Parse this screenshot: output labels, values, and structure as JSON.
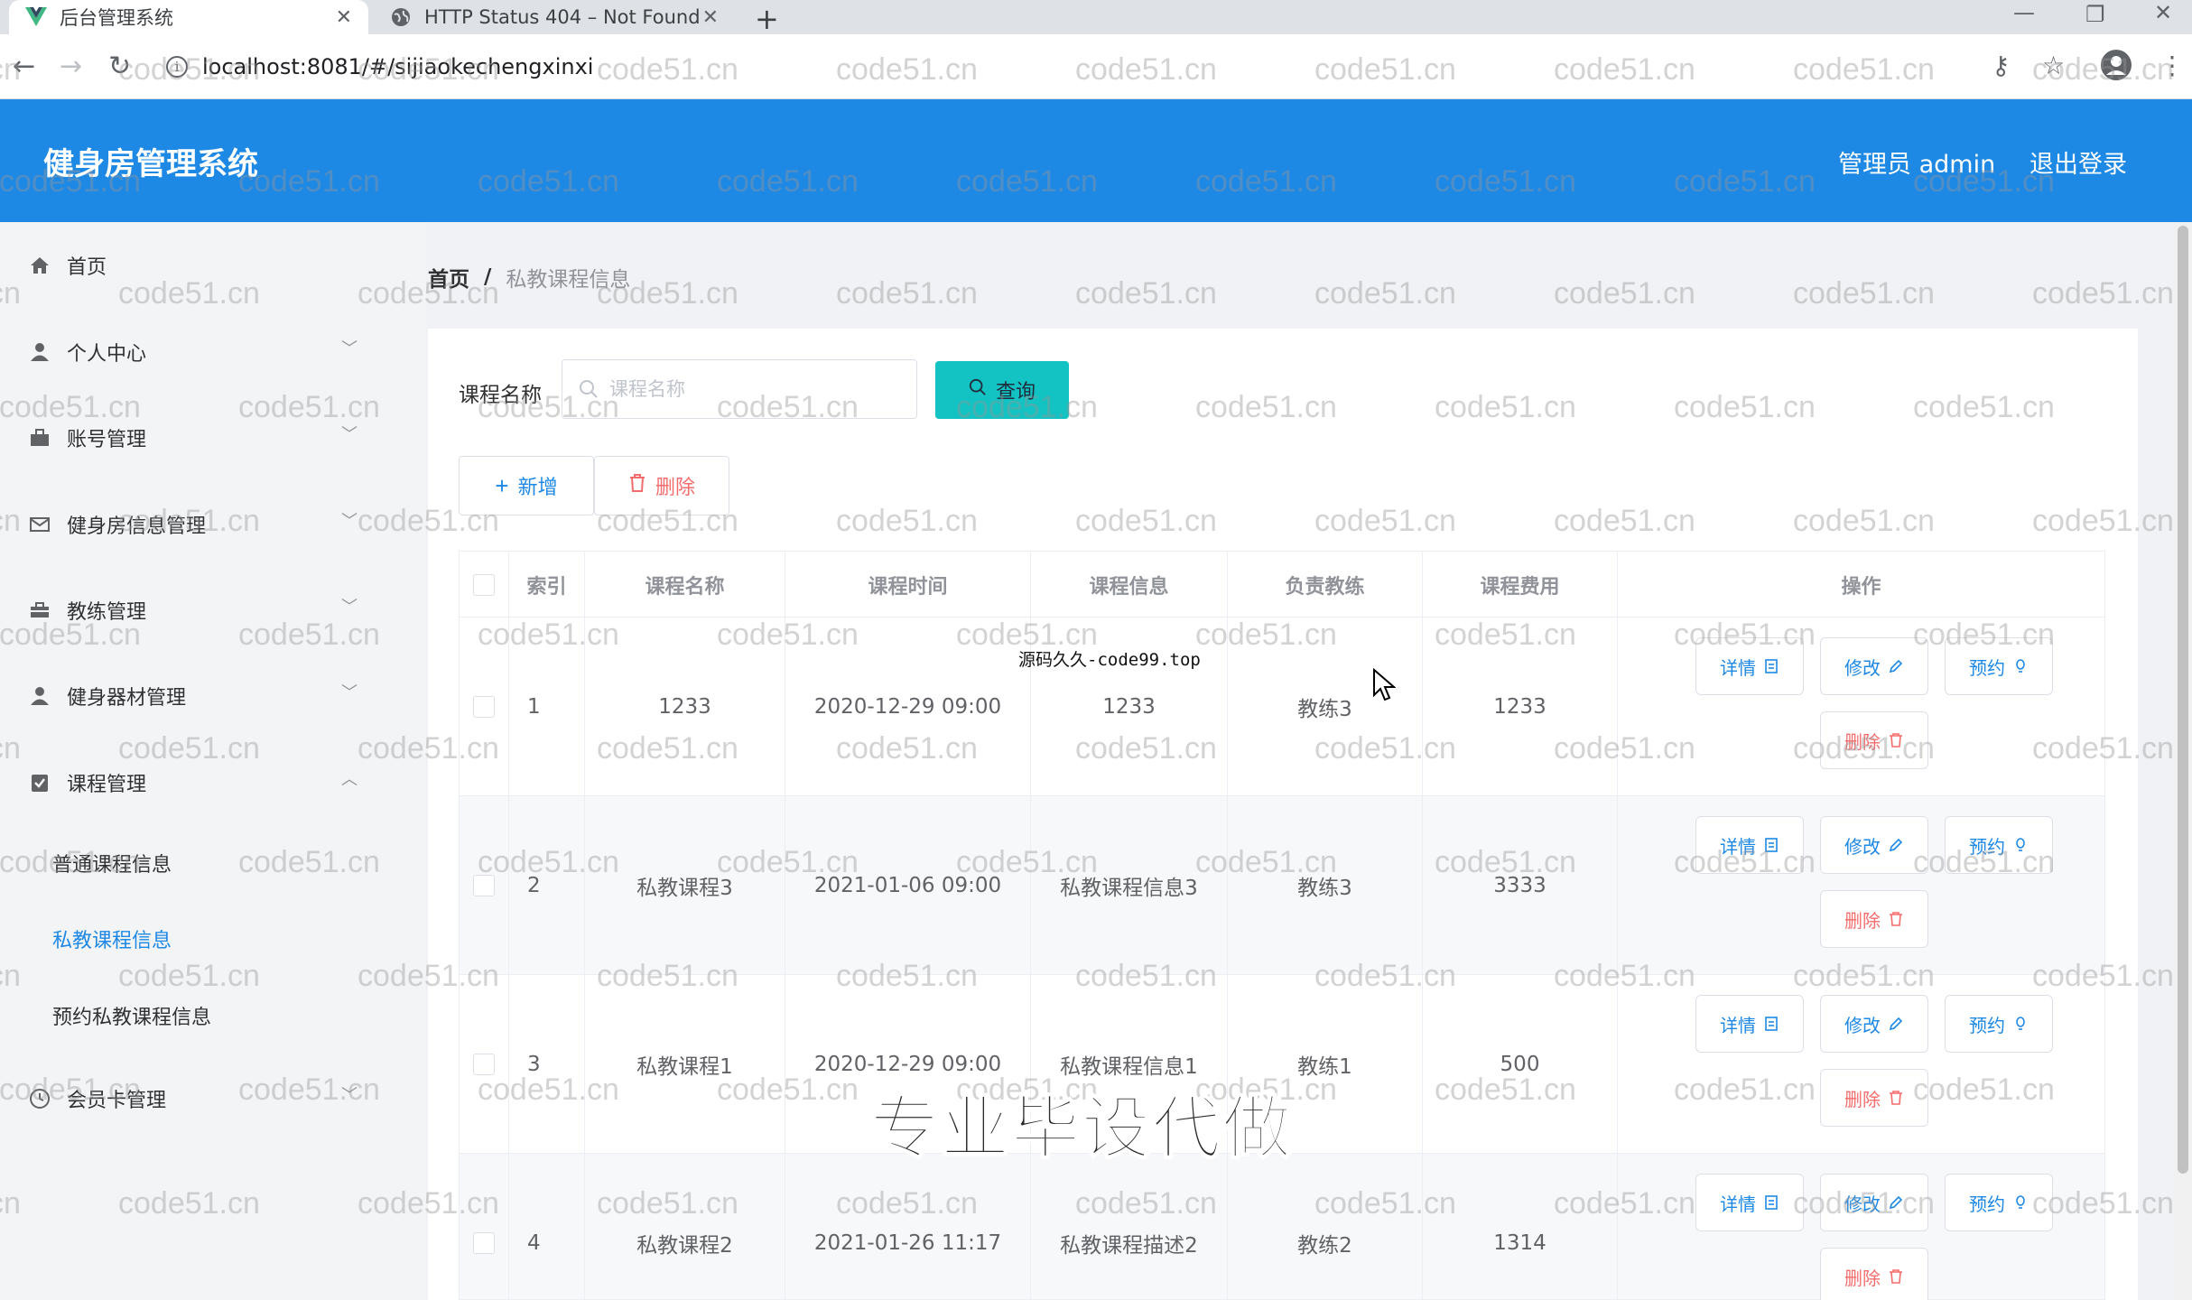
{
  "browser": {
    "tabs": [
      {
        "title": "后台管理系统",
        "icon": "vue-logo-icon",
        "active": true
      },
      {
        "title": "HTTP Status 404 – Not Found",
        "icon": "globe-icon",
        "active": false
      }
    ],
    "url": "localhost:8081/#/sijiaokechengxinxi"
  },
  "header": {
    "title": "健身房管理系统",
    "user": "管理员 admin",
    "logout": "退出登录"
  },
  "sidebar": {
    "items": [
      {
        "label": "首页",
        "icon": "home-icon"
      },
      {
        "label": "个人中心",
        "icon": "user-icon"
      },
      {
        "label": "账号管理",
        "icon": "briefcase-icon"
      },
      {
        "label": "健身房信息管理",
        "icon": "mail-icon"
      },
      {
        "label": "教练管理",
        "icon": "suitcase-icon"
      },
      {
        "label": "健身器材管理",
        "icon": "user-icon"
      },
      {
        "label": "课程管理",
        "icon": "checklist-icon"
      },
      {
        "label": "会员卡管理",
        "icon": "clock-icon"
      }
    ],
    "subitems": [
      "普通课程信息",
      "私教课程信息",
      "预约私教课程信息"
    ],
    "active": "私教课程信息"
  },
  "breadcrumb": {
    "home": "首页",
    "separator": "/",
    "current": "私教课程信息"
  },
  "search": {
    "label": "课程名称",
    "placeholder": "课程名称",
    "button": "查询"
  },
  "actions": {
    "add": "新增",
    "delete": "删除"
  },
  "table": {
    "headers": [
      "索引",
      "课程名称",
      "课程时间",
      "课程信息",
      "负责教练",
      "课程费用",
      "操作"
    ],
    "rows": [
      {
        "index": "1",
        "name": "1233",
        "time": "2020-12-29 09:00",
        "info": "1233",
        "coach": "教练3",
        "fee": "1233"
      },
      {
        "index": "2",
        "name": "私教课程3",
        "time": "2021-01-06 09:00",
        "info": "私教课程信息3",
        "coach": "教练3",
        "fee": "3333"
      },
      {
        "index": "3",
        "name": "私教课程1",
        "time": "2020-12-29 09:00",
        "info": "私教课程信息1",
        "coach": "教练1",
        "fee": "500"
      },
      {
        "index": "4",
        "name": "私教课程2",
        "time": "2021-01-26 11:17",
        "info": "私教课程描述2",
        "coach": "教练2",
        "fee": "1314"
      }
    ],
    "row_actions": {
      "detail": "详情",
      "edit": "修改",
      "book": "预约",
      "delete": "删除"
    }
  },
  "watermarks": {
    "repeat": "code51.cn",
    "small": "源码久久-code99.top",
    "big": "专业毕设代做"
  },
  "colors": {
    "header": "#1e88e5",
    "primary": "#1e88e5",
    "danger": "#f56c6c",
    "query": "#13c2c2"
  }
}
